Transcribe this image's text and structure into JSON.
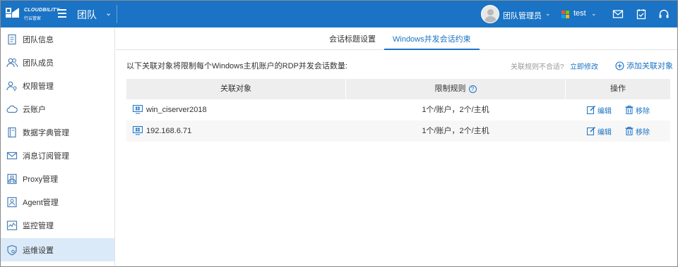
{
  "header": {
    "logo_text": "CLOUDBILITY",
    "logo_sub": "行云管家",
    "team_title": "团队",
    "user_name": "团队管理员",
    "org_name": "test",
    "brand_color": "#1a73c4"
  },
  "sidebar": {
    "items": [
      {
        "label": "团队信息",
        "icon": "document-icon"
      },
      {
        "label": "团队成员",
        "icon": "users-icon"
      },
      {
        "label": "权限管理",
        "icon": "user-key-icon"
      },
      {
        "label": "云账户",
        "icon": "cloud-icon"
      },
      {
        "label": "数据字典管理",
        "icon": "book-icon"
      },
      {
        "label": "消息订阅管理",
        "icon": "mail-icon"
      },
      {
        "label": "Proxy管理",
        "icon": "proxy-icon"
      },
      {
        "label": "Agent管理",
        "icon": "agent-icon"
      },
      {
        "label": "监控管理",
        "icon": "monitor-icon"
      },
      {
        "label": "运维设置",
        "icon": "shield-gear-icon",
        "active": true
      }
    ]
  },
  "tabs": [
    {
      "label": "会话标题设置",
      "active": false
    },
    {
      "label": "Windows并发会话约束",
      "active": true
    }
  ],
  "main": {
    "description": "以下关联对象将限制每个Windows主机账户的RDP并发会话数量:",
    "hint": "关联规则不合适?",
    "hint_link": "立即修改",
    "add_label": "添加关联对象"
  },
  "table": {
    "columns": [
      "关联对象",
      "限制规则",
      "操作"
    ],
    "rows": [
      {
        "target": "win_ciserver2018",
        "rule": "1个/账户，2个/主机",
        "edit": "编辑",
        "remove": "移除"
      },
      {
        "target": "192.168.6.71",
        "rule": "1个/账户，2个/主机",
        "edit": "编辑",
        "remove": "移除"
      }
    ]
  }
}
